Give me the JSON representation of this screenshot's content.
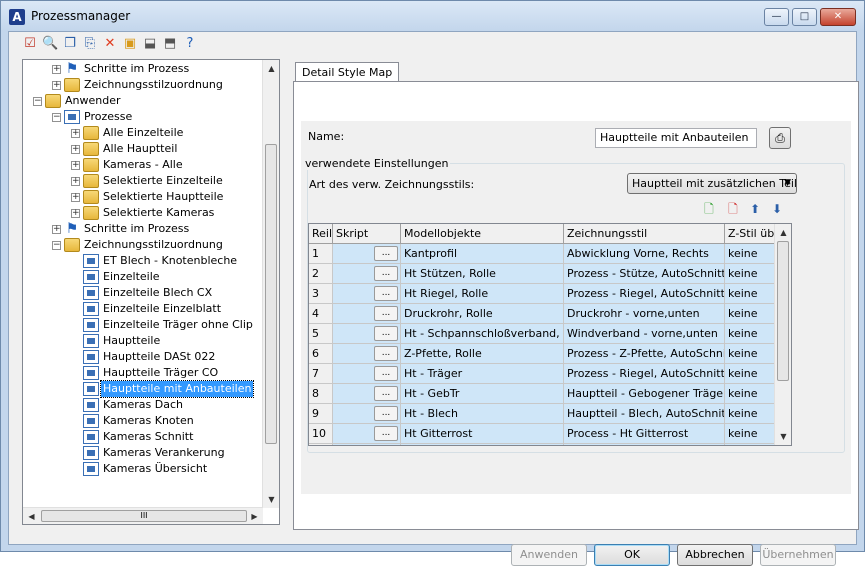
{
  "window": {
    "title": "Prozessmanager",
    "app_icon_letter": "A",
    "min": "—",
    "max": "□",
    "close": "✕"
  },
  "toolbar": [
    {
      "name": "check-document-icon",
      "glyph": "☑",
      "color": "#c0392b"
    },
    {
      "name": "search-document-icon",
      "glyph": "🔍",
      "color": "#555555"
    },
    {
      "name": "copy-document-icon",
      "glyph": "❐",
      "color": "#2b5fa8"
    },
    {
      "name": "paste-document-icon",
      "glyph": "⎘",
      "color": "#2b5fa8"
    },
    {
      "name": "delete-icon",
      "glyph": "✕",
      "color": "#e03c1f"
    },
    {
      "name": "screen-icon",
      "glyph": "▣",
      "color": "#d89a1a"
    },
    {
      "name": "import-icon",
      "glyph": "⬓",
      "color": "#555555"
    },
    {
      "name": "export-icon",
      "glyph": "⬒",
      "color": "#555555"
    },
    {
      "name": "help-icon",
      "glyph": "?",
      "color": "#1f5fb8"
    }
  ],
  "tree": [
    {
      "level": 2,
      "exp": "+",
      "icon": "flag",
      "label": "Schritte im Prozess"
    },
    {
      "level": 2,
      "exp": "+",
      "icon": "folder",
      "label": "Zeichnungsstilzuordnung"
    },
    {
      "level": 1,
      "exp": "−",
      "icon": "folder",
      "label": "Anwender"
    },
    {
      "level": 2,
      "exp": "−",
      "icon": "proc",
      "label": "Prozesse"
    },
    {
      "level": 3,
      "exp": "+",
      "icon": "folder",
      "label": "Alle Einzelteile"
    },
    {
      "level": 3,
      "exp": "+",
      "icon": "folder",
      "label": "Alle Hauptteil"
    },
    {
      "level": 3,
      "exp": "+",
      "icon": "folder",
      "label": "Kameras - Alle"
    },
    {
      "level": 3,
      "exp": "+",
      "icon": "folder",
      "label": "Selektierte Einzelteile"
    },
    {
      "level": 3,
      "exp": "+",
      "icon": "folder",
      "label": "Selektierte Hauptteile"
    },
    {
      "level": 3,
      "exp": "+",
      "icon": "folder",
      "label": "Selektierte Kameras"
    },
    {
      "level": 2,
      "exp": "+",
      "icon": "flag",
      "label": "Schritte im Prozess"
    },
    {
      "level": 2,
      "exp": "−",
      "icon": "folder",
      "label": "Zeichnungsstilzuordnung"
    },
    {
      "level": 3,
      "exp": "",
      "icon": "proc",
      "label": "ET Blech - Knotenbleche"
    },
    {
      "level": 3,
      "exp": "",
      "icon": "proc",
      "label": "Einzelteile"
    },
    {
      "level": 3,
      "exp": "",
      "icon": "proc",
      "label": "Einzelteile Blech CX"
    },
    {
      "level": 3,
      "exp": "",
      "icon": "proc",
      "label": "Einzelteile Einzelblatt"
    },
    {
      "level": 3,
      "exp": "",
      "icon": "proc",
      "label": "Einzelteile Träger ohne Clip"
    },
    {
      "level": 3,
      "exp": "",
      "icon": "proc",
      "label": "Hauptteile"
    },
    {
      "level": 3,
      "exp": "",
      "icon": "proc",
      "label": "Hauptteile DASt 022"
    },
    {
      "level": 3,
      "exp": "",
      "icon": "proc",
      "label": "Hauptteile Träger CO"
    },
    {
      "level": 3,
      "exp": "",
      "icon": "proc",
      "label": "Hauptteile mit Anbauteilen",
      "selected": true
    },
    {
      "level": 3,
      "exp": "",
      "icon": "proc",
      "label": "Kameras Dach"
    },
    {
      "level": 3,
      "exp": "",
      "icon": "proc",
      "label": "Kameras Knoten"
    },
    {
      "level": 3,
      "exp": "",
      "icon": "proc",
      "label": "Kameras Schnitt"
    },
    {
      "level": 3,
      "exp": "",
      "icon": "proc",
      "label": "Kameras Verankerung"
    },
    {
      "level": 3,
      "exp": "",
      "icon": "proc",
      "label": "Kameras Übersicht"
    }
  ],
  "tree_hscroll": "III",
  "tab": {
    "label": "Detail Style Map"
  },
  "form": {
    "name_label": "Name:",
    "name_value": "Hauptteile mit Anbauteilen",
    "group_label": "verwendete Einstellungen",
    "style_type_label": "Art des verw. Zeichnungsstils:",
    "style_type_value": "Hauptteil mit zusätzlichen Teilen"
  },
  "grid": {
    "columns": [
      "Reil",
      "Skript",
      "Modellobjekte",
      "Zeichnungsstil",
      "Z-Stil üb"
    ],
    "rows": [
      [
        "1",
        "Kantprofil",
        "Abwicklung Vorne, Rechts",
        "keine"
      ],
      [
        "2",
        "Ht Stützen, Rolle",
        "Prozess - Stütze, AutoSchnitte",
        "keine"
      ],
      [
        "3",
        "Ht Riegel, Rolle",
        "Prozess - Riegel, AutoSchnitte",
        "keine"
      ],
      [
        "4",
        "Druckrohr, Rolle",
        "Druckrohr - vorne,unten",
        "keine"
      ],
      [
        "5",
        "Ht - Schpannschloßverband, Rolle",
        "Windverband - vorne,unten",
        "keine"
      ],
      [
        "6",
        "Z-Pfette, Rolle",
        "Prozess - Z-Pfette, AutoSchnitte",
        "keine"
      ],
      [
        "7",
        "Ht - Träger",
        "Prozess - Riegel, AutoSchnitte",
        "keine"
      ],
      [
        "8",
        "Ht - GebTr",
        "Hauptteil - Gebogener Träger",
        "keine"
      ],
      [
        "9",
        "Ht - Blech",
        "Hauptteil - Blech, AutoSchnitte",
        "keine"
      ],
      [
        "10",
        "Ht Gitterrost",
        "Process - Ht Gitterrost",
        "keine"
      ]
    ],
    "dots": "..."
  },
  "buttons": {
    "apply": "Anwenden",
    "ok": "OK",
    "cancel": "Abbrechen",
    "take_over": "Übernehmen"
  }
}
